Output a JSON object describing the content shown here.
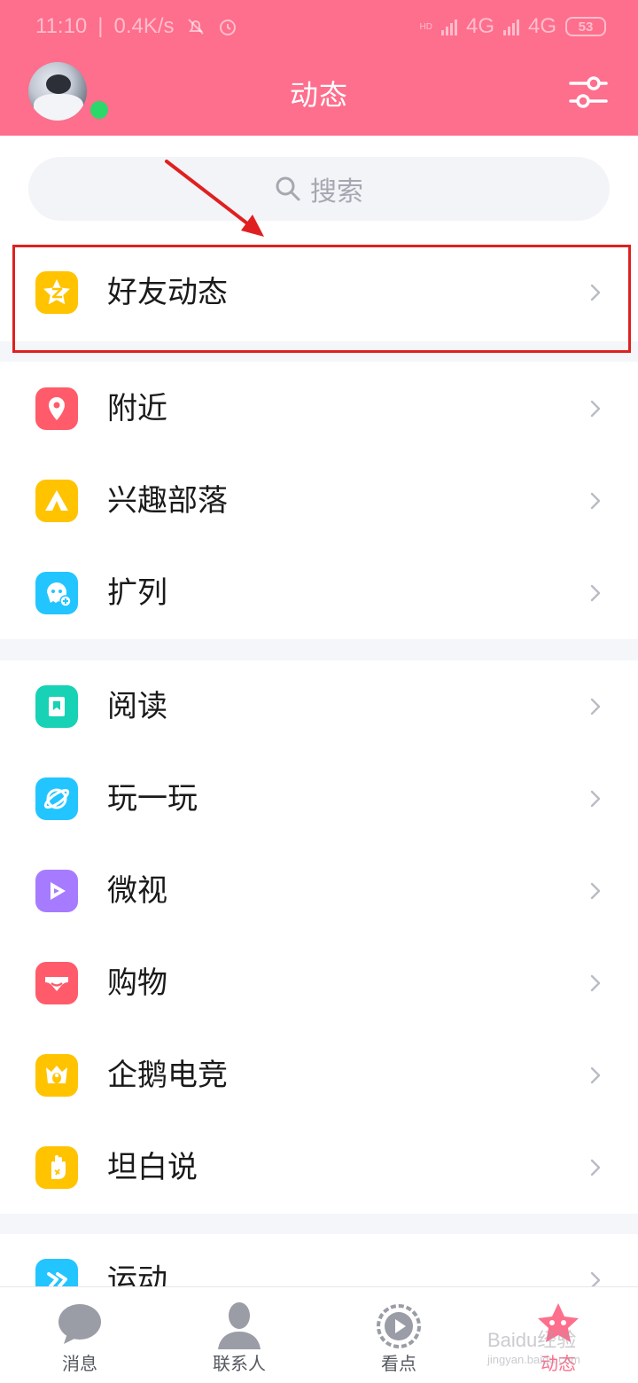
{
  "status_bar": {
    "time": "11:10",
    "net_speed": "0.4K/s",
    "hd_label": "HD",
    "network_1": "4G",
    "network_2": "4G",
    "battery": "53"
  },
  "header": {
    "title": "动态",
    "accent_color": "#fe6e8d",
    "online_status_color": "#2cd86a",
    "settings_icon": "sliders-icon"
  },
  "search": {
    "placeholder": "搜索",
    "icon": "search-icon"
  },
  "sections": [
    {
      "items": [
        {
          "label": "好友动态",
          "icon": "qzone-star-icon",
          "icon_color": "#ffc300"
        }
      ]
    },
    {
      "items": [
        {
          "label": "附近",
          "icon": "location-pin-icon",
          "icon_color": "#ff5b6b"
        },
        {
          "label": "兴趣部落",
          "icon": "tent-icon",
          "icon_color": "#ffc300"
        },
        {
          "label": "扩列",
          "icon": "ghost-add-icon",
          "icon_color": "#22c5ff"
        }
      ]
    },
    {
      "items": [
        {
          "label": "阅读",
          "icon": "book-icon",
          "icon_color": "#17d2b4"
        },
        {
          "label": "玩一玩",
          "icon": "planet-icon",
          "icon_color": "#22c5ff"
        },
        {
          "label": "微视",
          "icon": "play-video-icon",
          "icon_color": "#a77bff"
        },
        {
          "label": "购物",
          "icon": "shopping-bow-icon",
          "icon_color": "#ff5b6b"
        },
        {
          "label": "企鹅电竞",
          "icon": "crown-penguin-icon",
          "icon_color": "#ffc300"
        },
        {
          "label": "坦白说",
          "icon": "hand-icon",
          "icon_color": "#ffc300"
        }
      ]
    },
    {
      "items": [
        {
          "label": "运动",
          "icon": "running-icon",
          "icon_color": "#22c5ff"
        }
      ]
    }
  ],
  "bottom_nav": [
    {
      "label": "消息",
      "icon": "chat-bubble-icon",
      "active": false
    },
    {
      "label": "联系人",
      "icon": "person-icon",
      "active": false
    },
    {
      "label": "看点",
      "icon": "play-circle-icon",
      "active": false
    },
    {
      "label": "动态",
      "icon": "star-icon",
      "active": true
    }
  ],
  "watermark": {
    "text": "Baidu经验",
    "sub": "jingyan.baidu.com"
  },
  "annotation": {
    "highlight_color": "#e02020"
  }
}
